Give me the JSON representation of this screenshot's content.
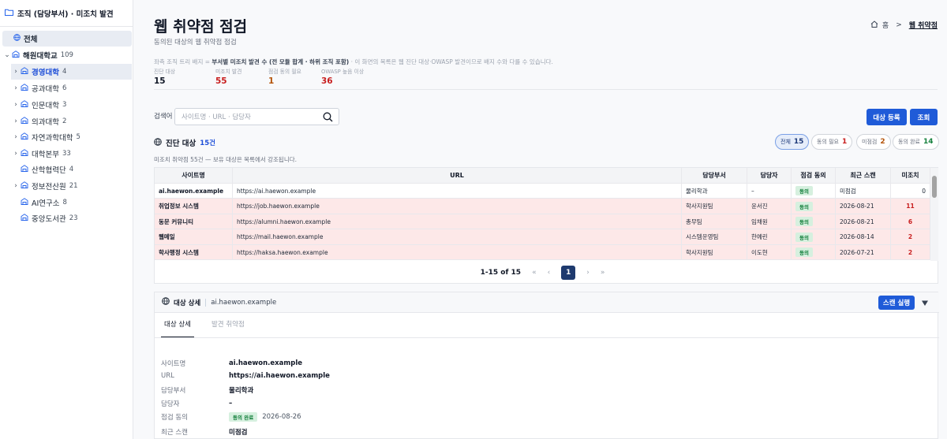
{
  "sidebar": {
    "header": "조직 (담당부서) · 미조치 발견",
    "all_label": "전체",
    "root": {
      "label": "해원대학교",
      "count": "109"
    },
    "items": [
      {
        "label": "경영대학",
        "count": "4"
      },
      {
        "label": "공과대학",
        "count": "6"
      },
      {
        "label": "인문대학",
        "count": "3"
      },
      {
        "label": "의과대학",
        "count": "2"
      },
      {
        "label": "자연과학대학",
        "count": "5"
      },
      {
        "label": "대학본부",
        "count": "33"
      },
      {
        "label": "산학협력단",
        "count": "4"
      },
      {
        "label": "정보전산원",
        "count": "21"
      },
      {
        "label": "AI연구소",
        "count": "8"
      },
      {
        "label": "중앙도서관",
        "count": "23"
      }
    ]
  },
  "header": {
    "title": "웹 취약점 점검",
    "subtitle": "동의된 대상의 웹 취약점 점검",
    "breadcrumb_home": "홈",
    "breadcrumb_sep": ">",
    "breadcrumb_current": "웹 취약점"
  },
  "notice": {
    "prefix": "좌측 조직 트리 배지 = ",
    "bold": "부서별 미조치 발견 수 (전 모듈 합계 · 하위 조직 포함)",
    "suffix": " · 이 화면의 목록은 웹 진단 대상·OWASP 발견이므로 배지 수와 다를 수 있습니다."
  },
  "stats": [
    {
      "label": "진단 대상",
      "value": "15",
      "color": "#111827"
    },
    {
      "label": "미조치 발견",
      "value": "55",
      "color": "#c81e1e"
    },
    {
      "label": "점검 동의 필요",
      "value": "1",
      "color": "#b45309"
    },
    {
      "label": "OWASP 높음 이상",
      "value": "36",
      "color": "#c81e1e"
    }
  ],
  "search": {
    "label": "검색어",
    "placeholder": "사이트명 · URL · 담당자"
  },
  "buttons": {
    "register": "대상 등록",
    "query": "조회",
    "scan": "스캔 실행"
  },
  "targets": {
    "title": "진단 대상",
    "count": "15건",
    "hint": "미조치 취약점 55건 — 보유 대상은 목록에서 강조됩니다.",
    "filters": [
      {
        "label": "전체",
        "count": "15",
        "color": "#1f3b7a"
      },
      {
        "label": "동의 필요",
        "count": "1",
        "color": "#c81e1e"
      },
      {
        "label": "미점검",
        "count": "2",
        "color": "#b45309"
      },
      {
        "label": "동의 완료",
        "count": "14",
        "color": "#15803d"
      }
    ]
  },
  "table": {
    "columns": [
      "사이트명",
      "URL",
      "담당부서",
      "담당자",
      "점검 동의",
      "최근 스캔",
      "미조치"
    ],
    "rows": [
      {
        "name": "ai.haewon.example",
        "url": "https://ai.haewon.example",
        "dept": "물리학과",
        "owner": "–",
        "consent": "동의",
        "scan": "미점검",
        "open": "0"
      },
      {
        "name": "취업정보 시스템",
        "url": "https://job.haewon.example",
        "dept": "학사지원팀",
        "owner": "윤서진",
        "consent": "동의",
        "scan": "2026-08-21",
        "open": "11"
      },
      {
        "name": "동문 커뮤니티",
        "url": "https://alumni.haewon.example",
        "dept": "총무팀",
        "owner": "임채원",
        "consent": "동의",
        "scan": "2026-08-21",
        "open": "6"
      },
      {
        "name": "웹메일",
        "url": "https://mail.haewon.example",
        "dept": "시스템운영팀",
        "owner": "한예린",
        "consent": "동의",
        "scan": "2026-08-14",
        "open": "2"
      },
      {
        "name": "학사행정 시스템",
        "url": "https://haksa.haewon.example",
        "dept": "학사지원팀",
        "owner": "이도현",
        "consent": "동의",
        "scan": "2026-07-21",
        "open": "2"
      }
    ]
  },
  "pager": {
    "range": "1-15 of 15",
    "first": "«",
    "prev": "‹",
    "page": "1",
    "next": "›",
    "last": "»"
  },
  "detail": {
    "title": "대상 상세",
    "target": "ai.haewon.example",
    "tabs": [
      "대상 상세",
      "발견 취약점"
    ],
    "fields": {
      "site_label": "사이트명",
      "site": "ai.haewon.example",
      "url_label": "URL",
      "url": "https://ai.haewon.example",
      "dept_label": "담당부서",
      "dept": "물리학과",
      "owner_label": "담당자",
      "owner": "–",
      "consent_label": "점검 동의",
      "consent": "동의 완료",
      "consent_date": "2026-08-26",
      "scan_label": "최근 스캔",
      "scan": "미점검"
    }
  }
}
